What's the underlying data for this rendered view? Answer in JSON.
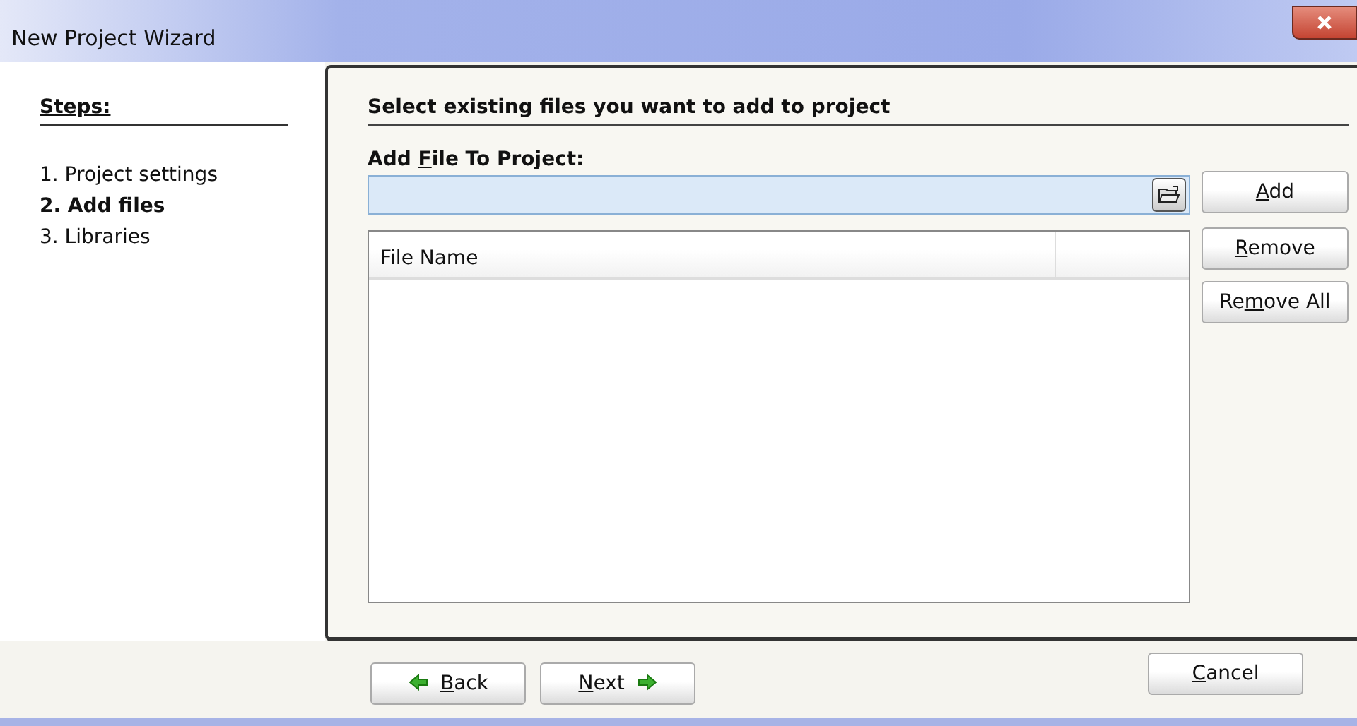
{
  "window": {
    "title": "New Project Wizard"
  },
  "steps": {
    "heading": "Steps:",
    "items": [
      {
        "label": "1. Project settings",
        "selected": false
      },
      {
        "label": "2. Add files",
        "selected": true
      },
      {
        "label": "3. Libraries",
        "selected": false
      }
    ]
  },
  "page": {
    "heading": "Select existing files you want to add to project",
    "field_label": {
      "before": "Add ",
      "key": "F",
      "after": "ile To Project:"
    },
    "file_list": {
      "columns": [
        "File Name"
      ]
    },
    "side_buttons": [
      {
        "label": {
          "key": "A",
          "after": "dd"
        }
      },
      {
        "label": {
          "key": "R",
          "after": "emove"
        }
      },
      {
        "label": {
          "before": "Re",
          "key": "m",
          "after": "ove All"
        }
      }
    ]
  },
  "footer": {
    "buttons": [
      {
        "kind": "back",
        "label": {
          "key": "B",
          "after": "ack"
        }
      },
      {
        "kind": "next",
        "label": {
          "key": "N",
          "after": "ext"
        }
      },
      {
        "kind": "cancel",
        "label": {
          "key": "C",
          "after": "ancel"
        }
      }
    ]
  }
}
